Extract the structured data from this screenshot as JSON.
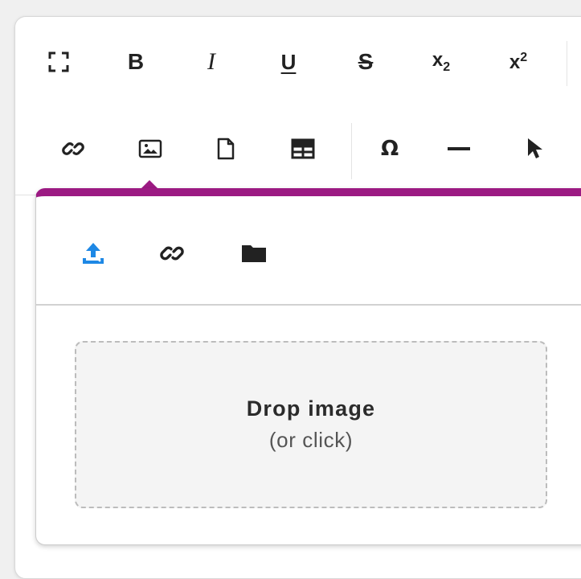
{
  "toolbar": {
    "row1": {
      "fullscreen": "fullscreen-icon",
      "bold_label": "B",
      "italic_label": "I",
      "underline_label": "U",
      "strike_label": "S",
      "subscript_base": "x",
      "subscript_mark": "2",
      "superscript_base": "x",
      "superscript_mark": "2"
    },
    "row2": {
      "link": "link-icon",
      "image": "image-icon",
      "file": "file-icon",
      "table": "table-icon",
      "special_char_label": "Ω",
      "horizontal_line": "horizontal-line-icon",
      "select": "cursor-icon"
    }
  },
  "image_popup": {
    "accent_color": "#9c1a83",
    "tabs": [
      {
        "icon": "upload-icon",
        "active": true,
        "color": "#1e88e5"
      },
      {
        "icon": "link-icon",
        "active": false
      },
      {
        "icon": "folder-icon",
        "active": false
      }
    ],
    "dropzone": {
      "title": "Drop image",
      "subtitle": "(or click)"
    }
  }
}
